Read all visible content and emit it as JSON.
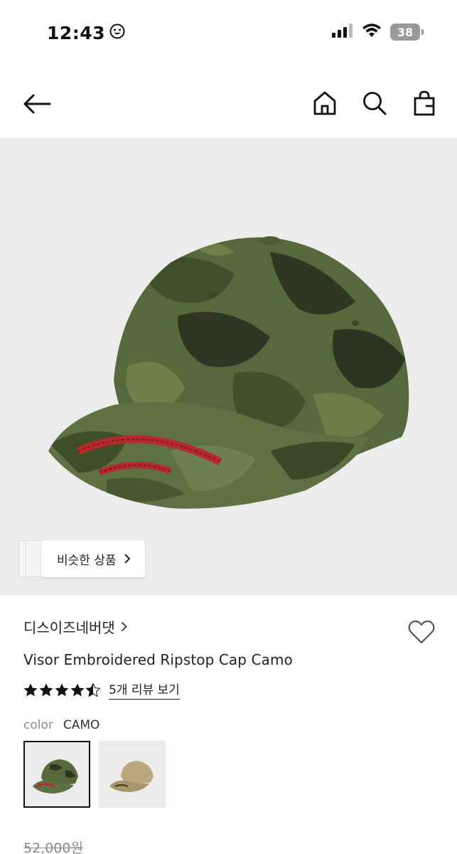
{
  "status_bar": {
    "time": "12:43",
    "battery": "38"
  },
  "nav": {
    "icons": [
      "back-arrow-icon",
      "home-icon",
      "search-icon",
      "shopping-bag-icon"
    ]
  },
  "hero": {
    "similar_products_label": "비슷한 상품",
    "colors": {
      "background": "#ececec",
      "camo_base": "#5a6d3e",
      "embroidery": "#b8292b"
    }
  },
  "product": {
    "brand": "디스이즈네버댓",
    "title": "Visor Embroidered Ripstop Cap Camo",
    "rating": 4.5,
    "review_link": "5개 리뷰 보기",
    "color_label": "color",
    "color_value": "CAMO",
    "swatches": [
      "CAMO",
      "BEIGE"
    ],
    "original_price": "52,000원"
  }
}
